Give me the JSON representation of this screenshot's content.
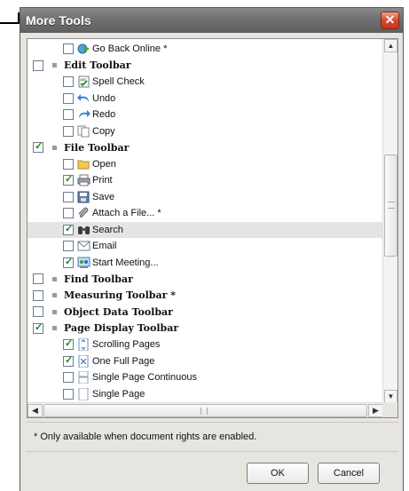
{
  "dialog": {
    "title": "More Tools",
    "close_glyph": "✕"
  },
  "rows": [
    {
      "kind": "item",
      "label": "Go Back Online *",
      "checked": false,
      "icon": "globe-arrow-icon"
    },
    {
      "kind": "group",
      "label": "Edit Toolbar",
      "checked": false
    },
    {
      "kind": "item",
      "label": "Spell Check",
      "checked": false,
      "icon": "spell-check-icon"
    },
    {
      "kind": "item",
      "label": "Undo",
      "checked": false,
      "icon": "undo-icon"
    },
    {
      "kind": "item",
      "label": "Redo",
      "checked": false,
      "icon": "redo-icon"
    },
    {
      "kind": "item",
      "label": "Copy",
      "checked": false,
      "icon": "copy-icon"
    },
    {
      "kind": "group",
      "label": "File Toolbar",
      "checked": true
    },
    {
      "kind": "item",
      "label": "Open",
      "checked": false,
      "icon": "folder-open-icon"
    },
    {
      "kind": "item",
      "label": "Print",
      "checked": true,
      "icon": "printer-icon"
    },
    {
      "kind": "item",
      "label": "Save",
      "checked": false,
      "icon": "save-icon"
    },
    {
      "kind": "item",
      "label": "Attach a File... *",
      "checked": false,
      "icon": "paperclip-icon"
    },
    {
      "kind": "item",
      "label": "Search",
      "checked": true,
      "icon": "binoculars-icon",
      "selected": true
    },
    {
      "kind": "item",
      "label": "Email",
      "checked": false,
      "icon": "email-icon"
    },
    {
      "kind": "item",
      "label": "Start Meeting...",
      "checked": true,
      "icon": "meeting-icon"
    },
    {
      "kind": "group",
      "label": "Find Toolbar",
      "checked": false
    },
    {
      "kind": "group",
      "label": "Measuring Toolbar *",
      "checked": false
    },
    {
      "kind": "group",
      "label": "Object Data Toolbar",
      "checked": false
    },
    {
      "kind": "group",
      "label": "Page Display Toolbar",
      "checked": true
    },
    {
      "kind": "item",
      "label": "Scrolling Pages",
      "checked": true,
      "icon": "scrolling-pages-icon"
    },
    {
      "kind": "item",
      "label": "One Full Page",
      "checked": true,
      "icon": "full-page-icon"
    },
    {
      "kind": "item",
      "label": "Single Page Continuous",
      "checked": false,
      "icon": "page-continuous-icon"
    },
    {
      "kind": "item",
      "label": "Single Page",
      "checked": false,
      "icon": "single-page-icon"
    }
  ],
  "scrollbar": {
    "up": "▲",
    "down": "▼",
    "left": "◀",
    "right": "▶"
  },
  "note": "* Only available when document rights are enabled.",
  "buttons": {
    "ok": "OK",
    "cancel": "Cancel"
  },
  "colors": {
    "titlebar": "#707070",
    "close": "#d9472b",
    "check": "#1d8a1d",
    "selection": "#e4e4e4"
  }
}
